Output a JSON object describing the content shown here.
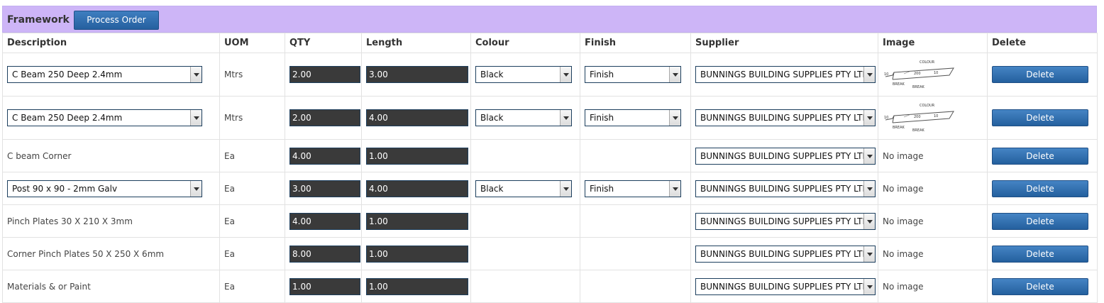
{
  "header": {
    "title": "Framework",
    "process_label": "Process Order"
  },
  "columns": [
    "Description",
    "UOM",
    "QTY",
    "Length",
    "Colour",
    "Finish",
    "Supplier",
    "Image",
    "Delete"
  ],
  "thumb_labels": {
    "colour": "COLOUR",
    "break": "BREAK",
    "w": "200",
    "a": "10",
    "b": "10"
  },
  "rows": [
    {
      "description": "C Beam 250 Deep 2.4mm",
      "uom": "Mtrs",
      "qty": "2.00",
      "length": "3.00",
      "colour": "Black",
      "finish": "Finish",
      "supplier": "BUNNINGS BUILDING SUPPLIES PTY LTD",
      "image": "",
      "delete_label": "Delete"
    },
    {
      "description": "C Beam 250 Deep 2.4mm",
      "uom": "Mtrs",
      "qty": "2.00",
      "length": "4.00",
      "colour": "Black",
      "finish": "Finish",
      "supplier": "BUNNINGS BUILDING SUPPLIES PTY LTD",
      "image": "",
      "delete_label": "Delete"
    },
    {
      "description": "C beam Corner",
      "uom": "Ea",
      "qty": "4.00",
      "length": "1.00",
      "colour": "",
      "finish": "",
      "supplier": "BUNNINGS BUILDING SUPPLIES PTY LTD",
      "image": "No image",
      "delete_label": "Delete"
    },
    {
      "description": "Post 90 x 90 - 2mm Galv",
      "uom": "Ea",
      "qty": "3.00",
      "length": "4.00",
      "colour": "Black",
      "finish": "Finish",
      "supplier": "BUNNINGS BUILDING SUPPLIES PTY LTD",
      "image": "No image",
      "delete_label": "Delete"
    },
    {
      "description": "Pinch Plates 30 X 210 X 3mm",
      "uom": "Ea",
      "qty": "4.00",
      "length": "1.00",
      "colour": "",
      "finish": "",
      "supplier": "BUNNINGS BUILDING SUPPLIES PTY LTD",
      "image": "No image",
      "delete_label": "Delete"
    },
    {
      "description": "Corner Pinch Plates 50 X 250 X 6mm",
      "uom": "Ea",
      "qty": "8.00",
      "length": "1.00",
      "colour": "",
      "finish": "",
      "supplier": "BUNNINGS BUILDING SUPPLIES PTY LTD",
      "image": "No image",
      "delete_label": "Delete"
    },
    {
      "description": "Materials & or Paint",
      "uom": "Ea",
      "qty": "1.00",
      "length": "1.00",
      "colour": "",
      "finish": "",
      "supplier": "BUNNINGS BUILDING SUPPLIES PTY LTD",
      "image": "No image",
      "delete_label": "Delete"
    }
  ]
}
